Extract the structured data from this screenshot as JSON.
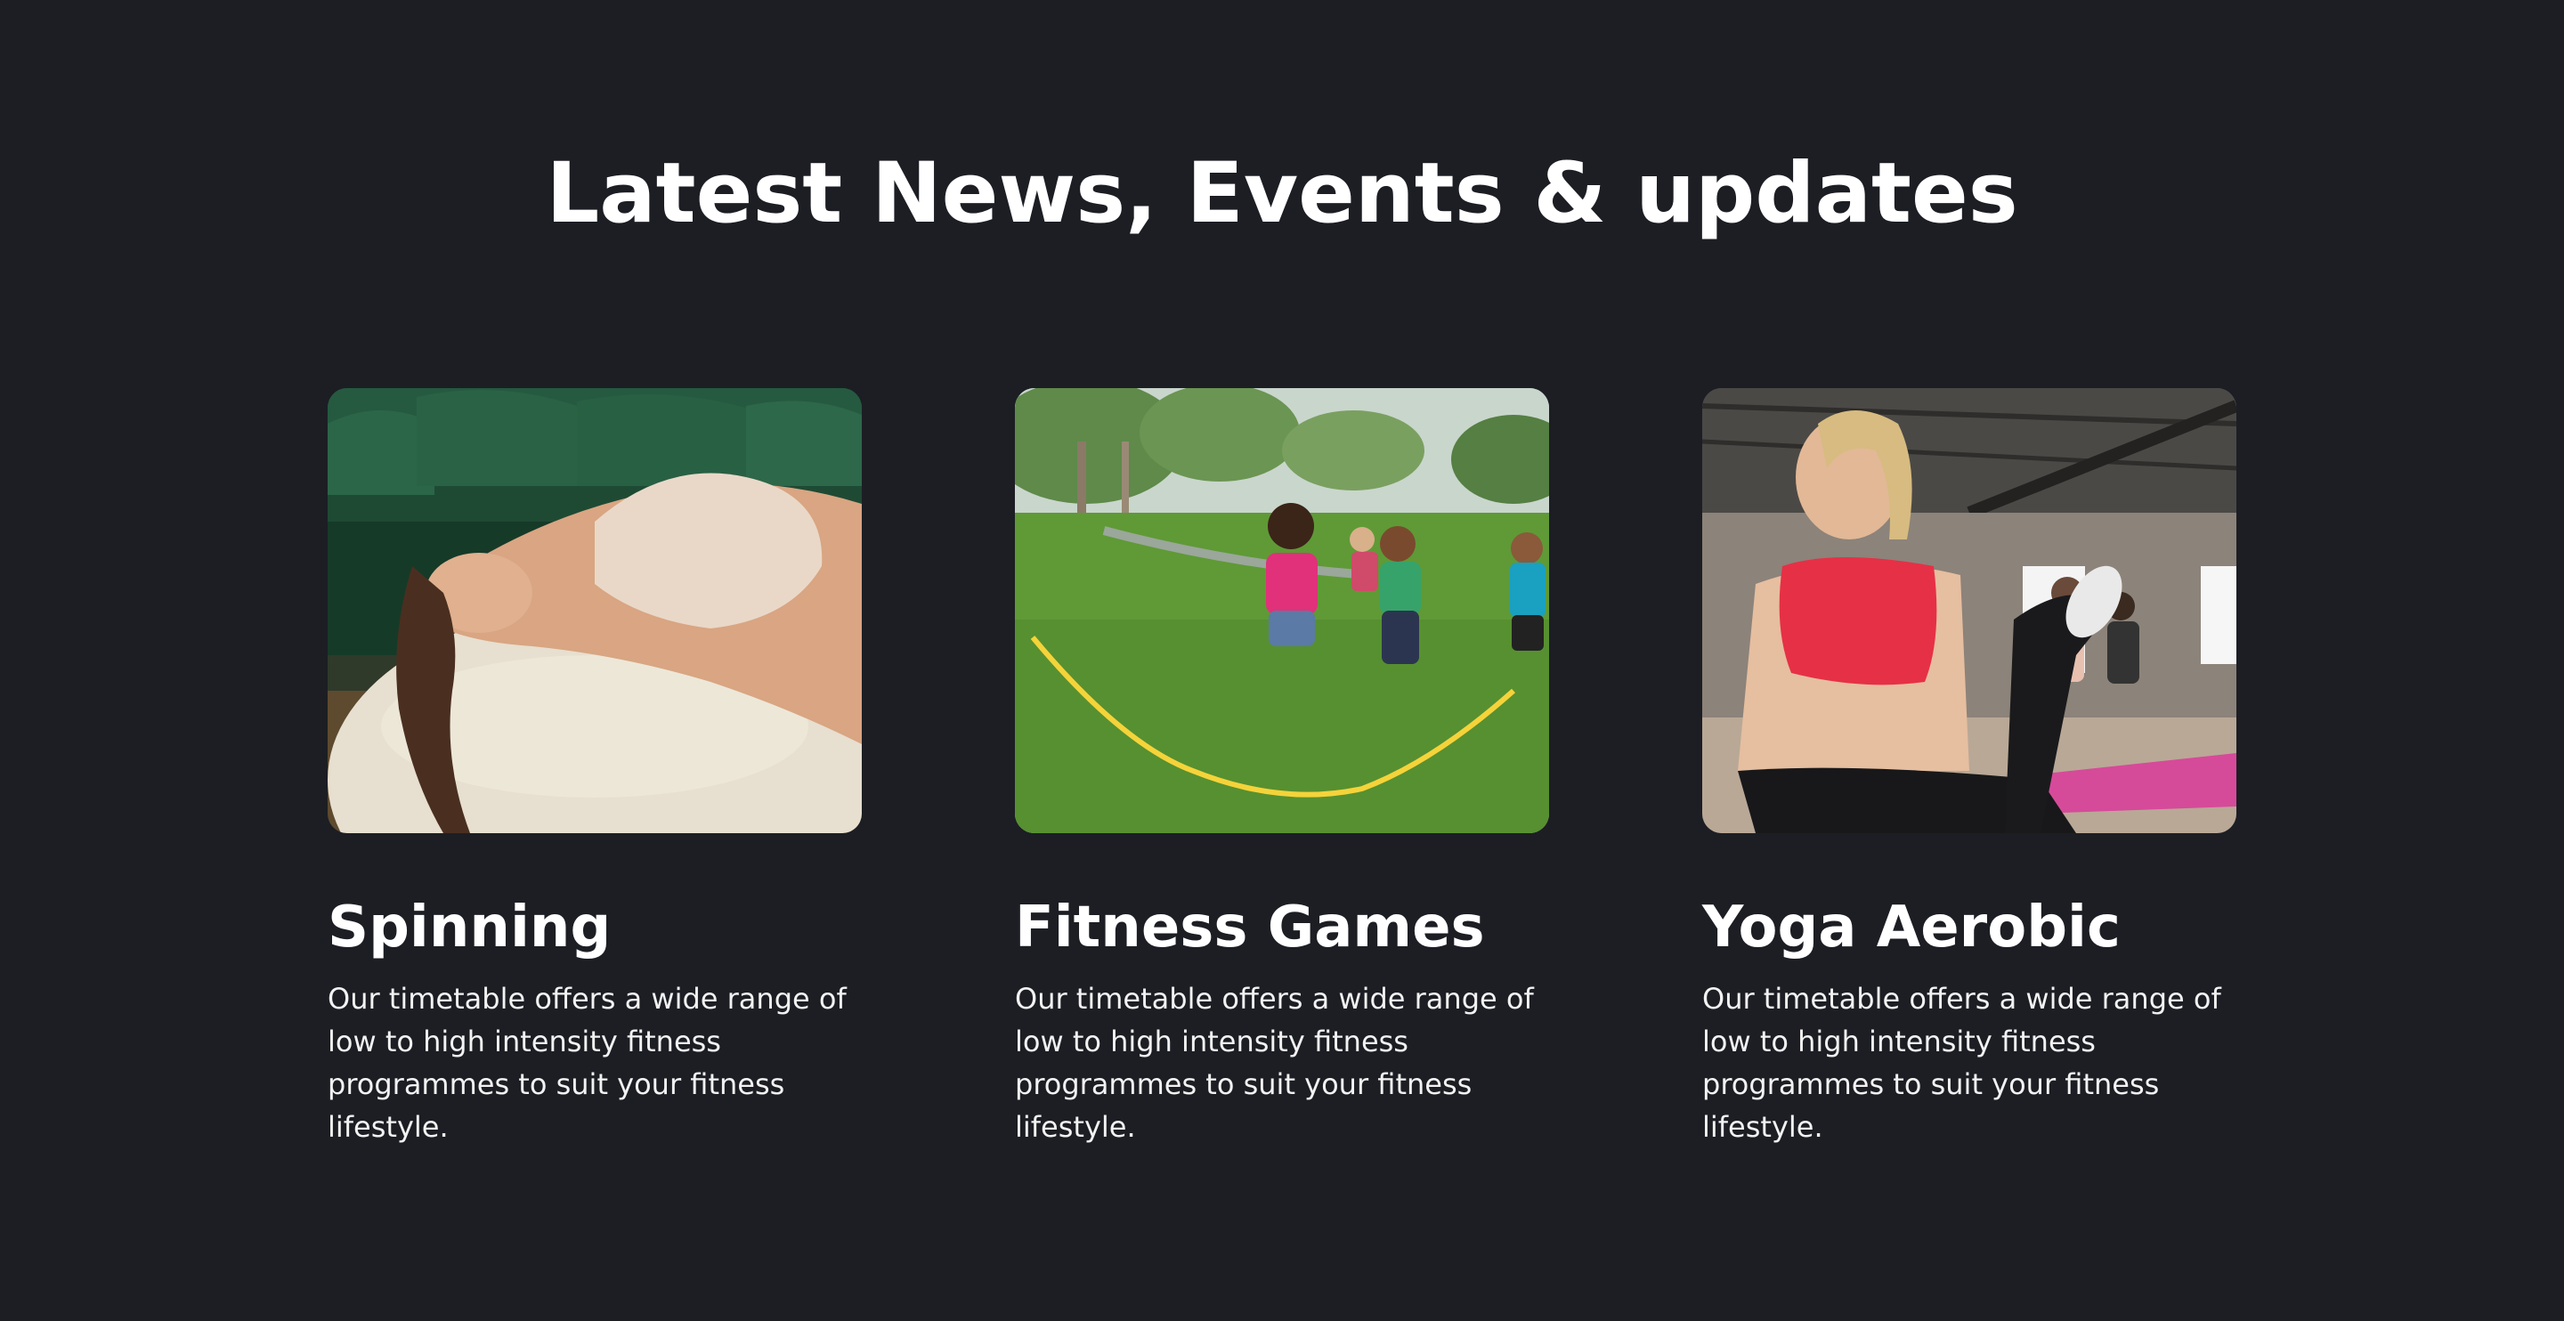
{
  "section": {
    "title": "Latest News, Events & updates"
  },
  "cards": [
    {
      "title": "Spinning",
      "description": "Our timetable offers a wide range of low to high intensity fitness programmes to suit your fitness lifestyle.",
      "image": "woman-on-exercise-ball-photo"
    },
    {
      "title": "Fitness Games",
      "description": "Our timetable offers a wide range of low to high intensity fitness programmes to suit your fitness lifestyle.",
      "image": "kids-jump-rope-park-photo"
    },
    {
      "title": "Yoga Aerobic",
      "description": "Our timetable offers a wide range of low to high intensity fitness programmes to suit your fitness lifestyle.",
      "image": "woman-yoga-class-photo"
    }
  ],
  "colors": {
    "background": "#1c1e24",
    "text": "#ffffff"
  }
}
